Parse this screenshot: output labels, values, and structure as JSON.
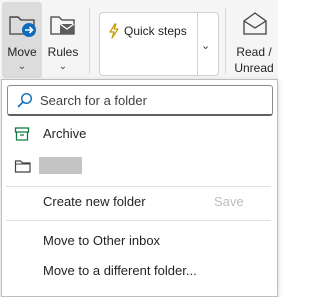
{
  "ribbon": {
    "move": {
      "label": "Move",
      "icon": "folder-move-icon"
    },
    "rules": {
      "label": "Rules",
      "icon": "rules-icon"
    },
    "quick_steps": {
      "label": "Quick steps",
      "icon": "lightning-icon"
    },
    "read_unread": {
      "label_line1": "Read /",
      "label_line2": "Unread",
      "icon": "envelope-open-icon"
    }
  },
  "menu": {
    "search_placeholder": "Search for a folder",
    "items": [
      {
        "label": "Archive",
        "icon": "archive-icon"
      },
      {
        "label": "",
        "icon": "folder-icon",
        "redacted": true
      }
    ],
    "create_new_folder": "Create new folder",
    "save_label": "Save",
    "move_to_other_inbox": "Move to Other inbox",
    "move_to_different_folder": "Move to a different folder..."
  },
  "colors": {
    "accent": "#0f6cbd",
    "archive_green": "#107c41",
    "ribbon_bg": "#f5f5f5"
  }
}
